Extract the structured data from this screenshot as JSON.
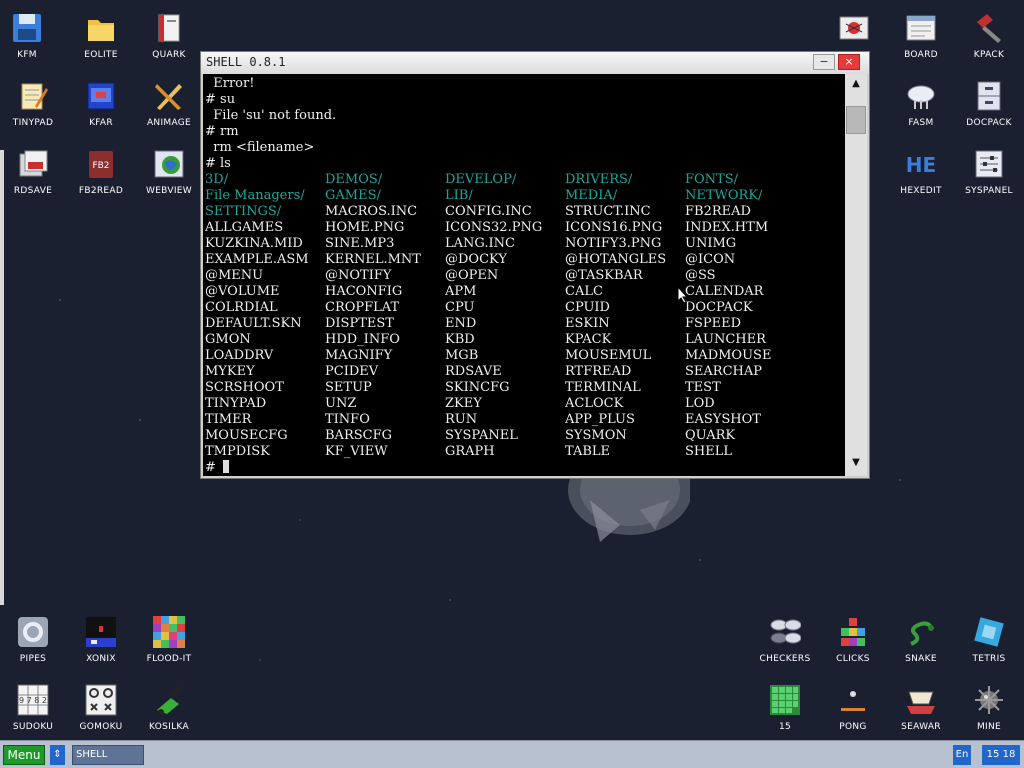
{
  "desktop": {
    "icons_left": [
      {
        "label": "KFM"
      },
      {
        "label": "EOLITE"
      },
      {
        "label": "QUARK"
      },
      {
        "label": "TINYPAD"
      },
      {
        "label": "KFAR"
      },
      {
        "label": "ANIMAGE"
      },
      {
        "label": "RDSAVE"
      },
      {
        "label": "FB2READ"
      },
      {
        "label": "WEBVIEW"
      }
    ],
    "icons_right": [
      {
        "label": "BOARD"
      },
      {
        "label": "KPACK"
      },
      {
        "label": "FASM"
      },
      {
        "label": "DOCPACK"
      },
      {
        "label": "HEXEDIT"
      },
      {
        "label": "SYSPANEL"
      }
    ],
    "icons_bottom_left": [
      {
        "label": "PIPES"
      },
      {
        "label": "XONIX"
      },
      {
        "label": "FLOOD-IT"
      },
      {
        "label": "SUDOKU"
      },
      {
        "label": "GOMOKU"
      },
      {
        "label": "KOSILKA"
      }
    ],
    "icons_bottom_right": [
      {
        "label": "CHECKERS"
      },
      {
        "label": "CLICKS"
      },
      {
        "label": "SNAKE"
      },
      {
        "label": "TETRIS"
      },
      {
        "label": "15"
      },
      {
        "label": "PONG"
      },
      {
        "label": "SEAWAR"
      },
      {
        "label": "MINE"
      }
    ],
    "fb2_badge": "FB2",
    "he_badge": "HE",
    "sudoku_digits": "9 7 8 2"
  },
  "window": {
    "title": "SHELL 0.8.1",
    "minimize_glyph": "−",
    "close_glyph": "×",
    "scroll_up": "▲",
    "scroll_down": "▼",
    "lines": [
      "  Error!",
      "# su",
      "  File 'su' not found.",
      "# rm",
      "  rm <filename>",
      "# ls"
    ],
    "prompt": "#",
    "listing": [
      [
        "3D/",
        "DEMOS/",
        "DEVELOP/",
        "DRIVERS/",
        "FONTS/"
      ],
      [
        "File Managers/",
        "GAMES/",
        "LIB/",
        "MEDIA/",
        "NETWORK/"
      ],
      [
        "SETTINGS/",
        "MACROS.INC",
        "CONFIG.INC",
        "STRUCT.INC",
        "FB2READ"
      ],
      [
        "ALLGAMES",
        "HOME.PNG",
        "ICONS32.PNG",
        "ICONS16.PNG",
        "INDEX.HTM"
      ],
      [
        "KUZKINA.MID",
        "SINE.MP3",
        "LANG.INC",
        "NOTIFY3.PNG",
        "UNIMG"
      ],
      [
        "EXAMPLE.ASM",
        "KERNEL.MNT",
        "@DOCKY",
        "@HOTANGLES",
        "@ICON"
      ],
      [
        "@MENU",
        "@NOTIFY",
        "@OPEN",
        "@TASKBAR",
        "@SS"
      ],
      [
        "@VOLUME",
        "HACONFIG",
        "APM",
        "CALC",
        "CALENDAR"
      ],
      [
        "COLRDIAL",
        "CROPFLAT",
        "CPU",
        "CPUID",
        "DOCPACK"
      ],
      [
        "DEFAULT.SKN",
        "DISPTEST",
        "END",
        "ESKIN",
        "FSPEED"
      ],
      [
        "GMON",
        "HDD_INFO",
        "KBD",
        "KPACK",
        "LAUNCHER"
      ],
      [
        "LOADDRV",
        "MAGNIFY",
        "MGB",
        "MOUSEMUL",
        "MADMOUSE"
      ],
      [
        "MYKEY",
        "PCIDEV",
        "RDSAVE",
        "RTFREAD",
        "SEARCHAP"
      ],
      [
        "SCRSHOOT",
        "SETUP",
        "SKINCFG",
        "TERMINAL",
        "TEST"
      ],
      [
        "TINYPAD",
        "UNZ",
        "ZKEY",
        "ACLOCK",
        "LOD"
      ],
      [
        "TIMER",
        "TINFO",
        "RUN",
        "APP_PLUS",
        "EASYSHOT"
      ],
      [
        "MOUSECFG",
        "BARSCFG",
        "SYSPANEL",
        "SYSMON",
        "QUARK"
      ],
      [
        "TMPDISK",
        "KF_VIEW",
        "GRAPH",
        "TABLE",
        "SHELL"
      ]
    ]
  },
  "taskbar": {
    "menu_label": "Menu",
    "switch_glyph": "⇕",
    "task_label": "SHELL",
    "lang": "En",
    "clock": "15 18"
  }
}
